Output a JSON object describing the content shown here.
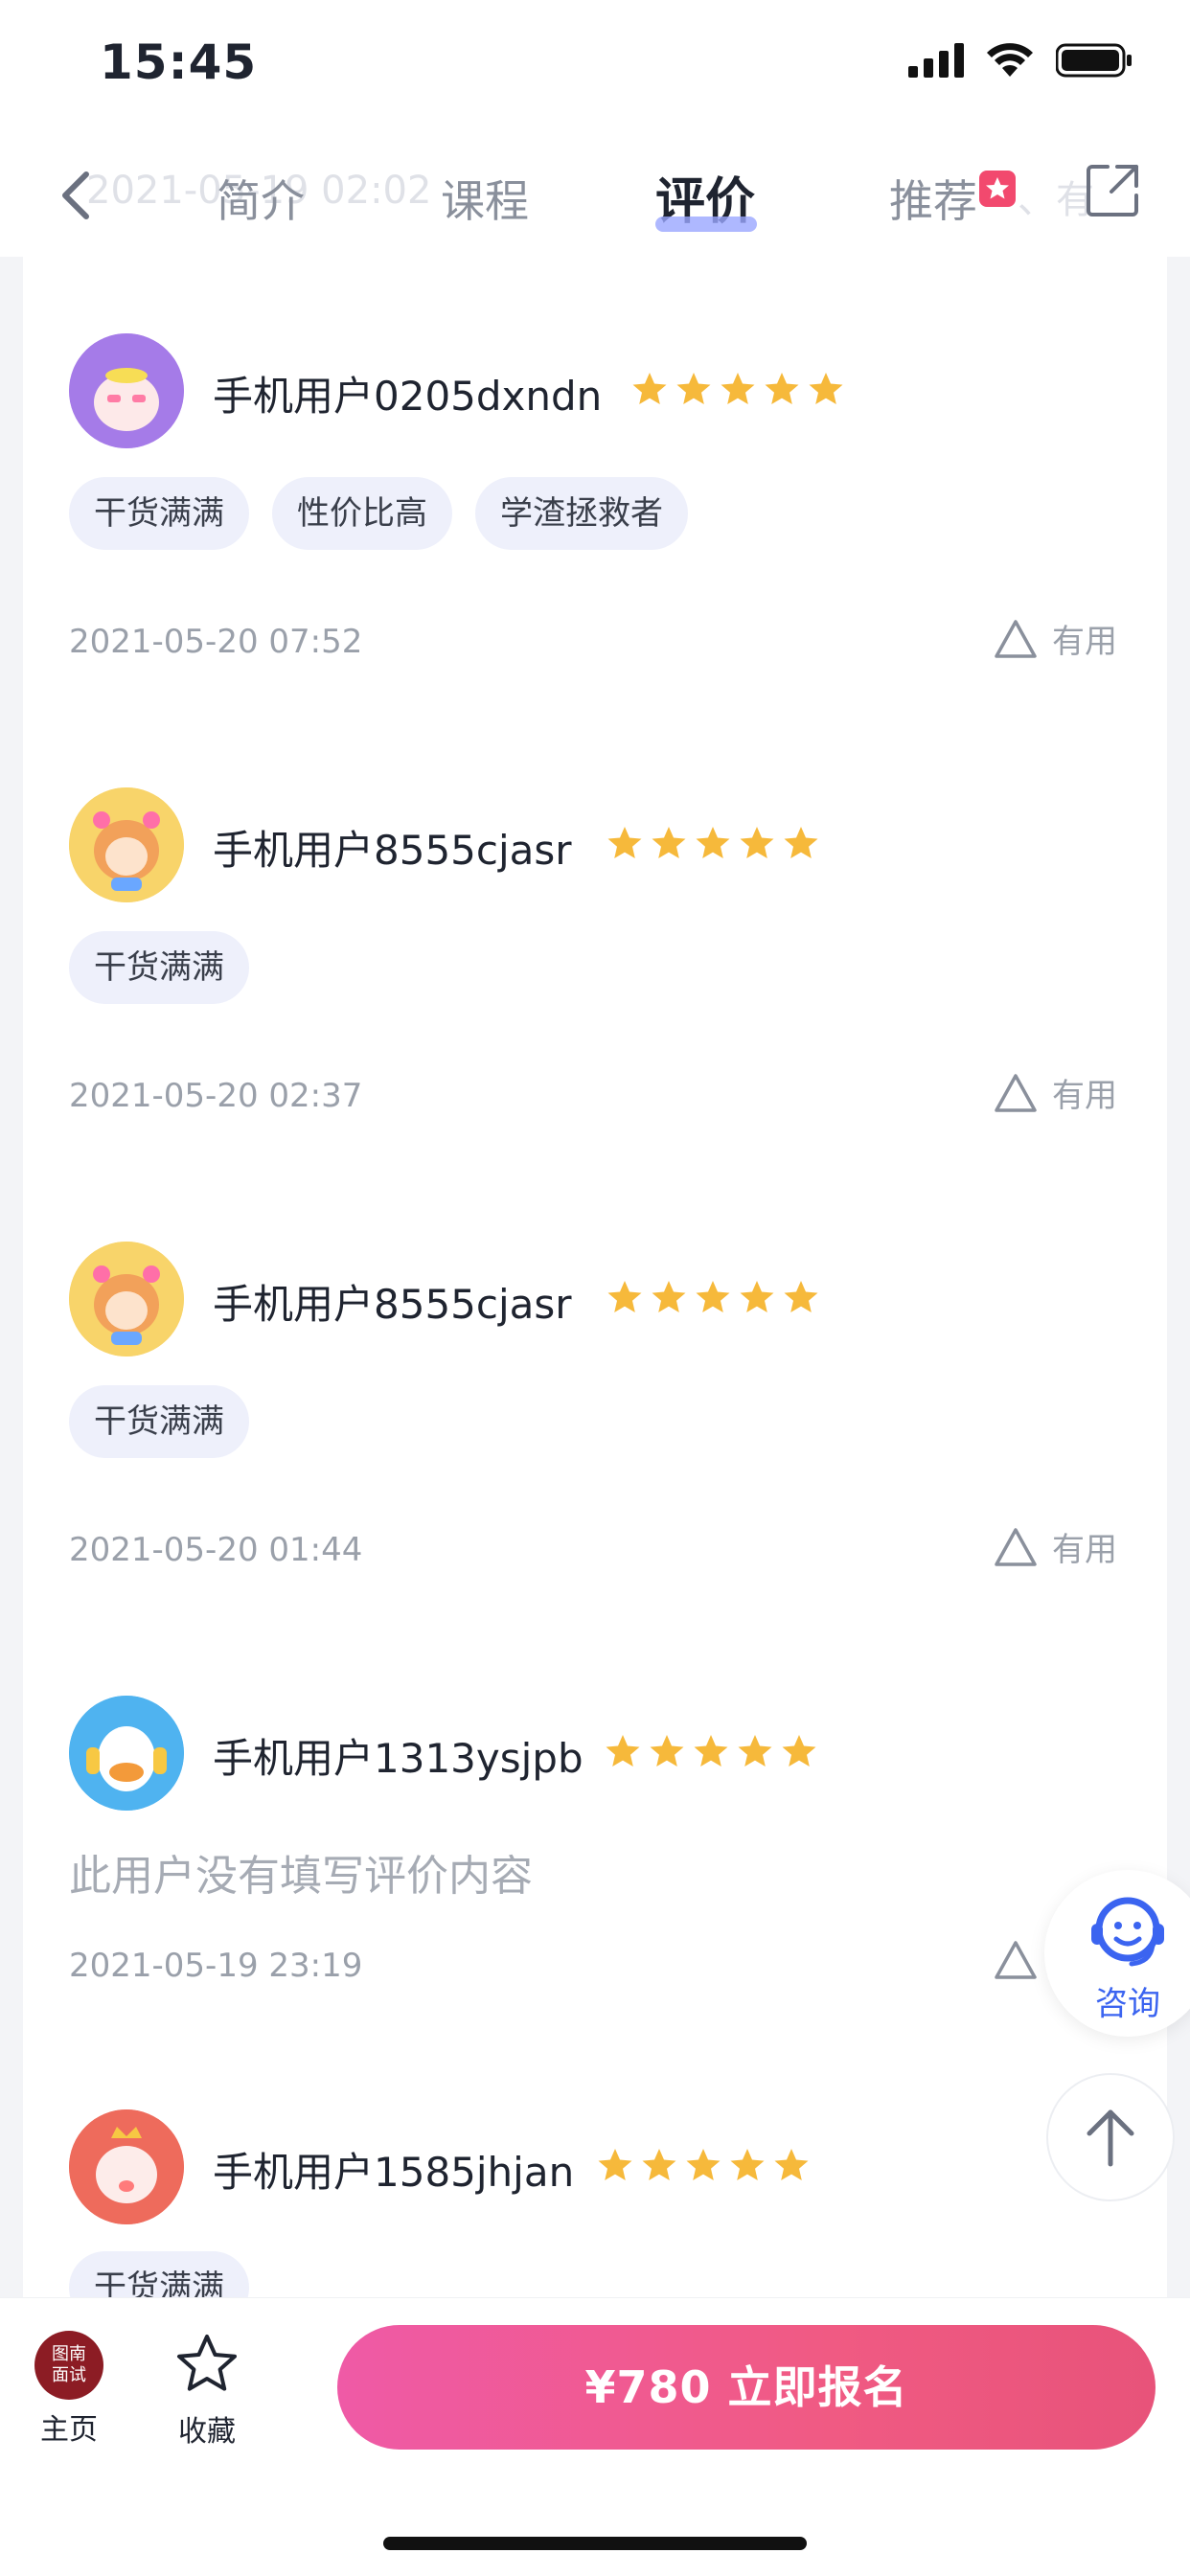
{
  "status_bar": {
    "time": "15:45"
  },
  "nav": {
    "ghost_text": "2021-05-19 02:02",
    "tabs": [
      "简介",
      "课程",
      "评价",
      "推荐"
    ],
    "active_tab": "评价",
    "ghost_right": "、有"
  },
  "reviews": [
    {
      "user": "手机用户0205dxndn",
      "rating": 5,
      "tags": [
        "干货满满",
        "性价比高",
        "学渣拯救者"
      ],
      "date": "2021-05-20 07:52",
      "useful_label": "有用"
    },
    {
      "user": "手机用户8555cjasr",
      "rating": 5,
      "tags": [
        "干货满满"
      ],
      "date": "2021-05-20 02:37",
      "useful_label": "有用"
    },
    {
      "user": "手机用户8555cjasr",
      "rating": 5,
      "tags": [
        "干货满满"
      ],
      "date": "2021-05-20 01:44",
      "useful_label": "有用"
    },
    {
      "user": "手机用户1313ysjpb",
      "rating": 5,
      "content": "此用户没有填写评价内容",
      "date": "2021-05-19 23:19"
    },
    {
      "user": "手机用户1585jhjan",
      "rating": 5,
      "tags": [
        "干货满满"
      ]
    }
  ],
  "floating": {
    "consult_label": "咨询"
  },
  "bottom_bar": {
    "home_logo_line1": "图南",
    "home_logo_line2": "面试",
    "home_label": "主页",
    "favorite_label": "收藏",
    "enroll_label": "¥780  立即报名"
  },
  "colors": {
    "accent": "#3b64f0",
    "star": "#f6b93b",
    "enroll": "#ef5aa6",
    "tag_bg": "#eef0fb"
  }
}
